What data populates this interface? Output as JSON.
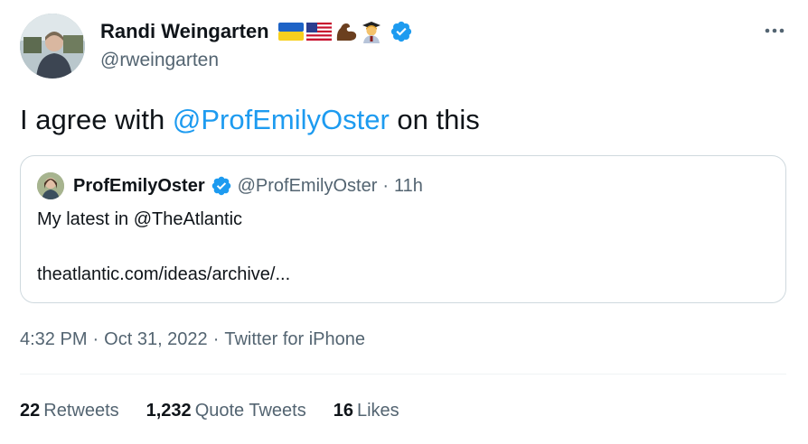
{
  "author": {
    "name": "Randi Weingarten",
    "handle": "@rweingarten"
  },
  "tweet": {
    "text_before": "I agree with ",
    "mention": "@ProfEmilyOster",
    "text_after": " on this"
  },
  "quote": {
    "name": "ProfEmilyOster",
    "handle": "@ProfEmilyOster",
    "dot": "·",
    "time": "11h",
    "line1": "My latest in @TheAtlantic",
    "line2": "theatlantic.com/ideas/archive/..."
  },
  "meta": {
    "time": "4:32 PM",
    "sep1": "·",
    "date": "Oct 31, 2022",
    "sep2": "·",
    "source": "Twitter for iPhone"
  },
  "stats": {
    "retweets_count": "22",
    "retweets_label": "Retweets",
    "quotes_count": "1,232",
    "quotes_label": "Quote Tweets",
    "likes_count": "16",
    "likes_label": "Likes"
  },
  "colors": {
    "accent": "#1d9bf0",
    "secondary_text": "#536471",
    "border": "#cfd9de"
  },
  "icons": {
    "verified": "verified-badge-icon",
    "more": "more-dots-icon",
    "flags": [
      "ukraine-flag-icon",
      "usa-flag-icon"
    ],
    "emoji": [
      "flexed-biceps-icon",
      "teacher-icon"
    ]
  }
}
